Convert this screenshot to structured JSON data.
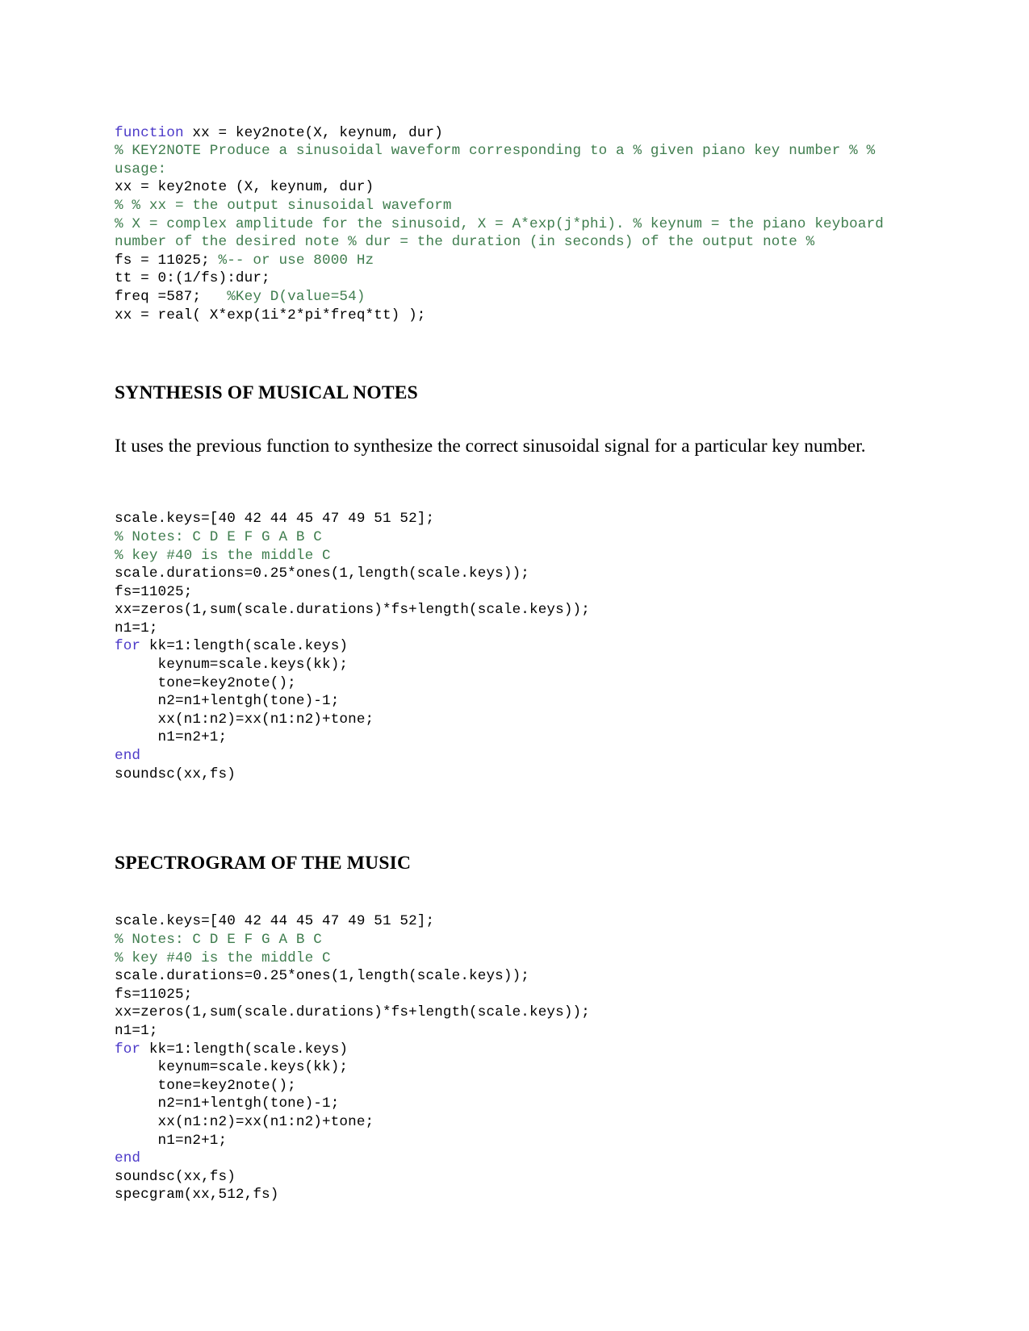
{
  "document": {
    "title": "Synthesis of Musical Notes - MATLAB code",
    "code_colors": {
      "keyword": "#4b39c8",
      "comment": "#3f7d4e",
      "plain": "#000000"
    }
  },
  "blocks": {
    "key2note_code": [
      [
        {
          "t": "function",
          "c": "kw"
        },
        {
          "t": " xx = key2note(X, keynum, dur)",
          "c": "plain"
        }
      ],
      [
        {
          "t": "% KEY2NOTE Produce a sinusoidal waveform corresponding to a % given piano key number % % usage:",
          "c": "comment"
        }
      ],
      [
        {
          "t": "xx = key2note (X, keynum, dur)",
          "c": "plain"
        }
      ],
      [
        {
          "t": "% % xx = the output sinusoidal waveform",
          "c": "comment"
        }
      ],
      [
        {
          "t": "% X = complex amplitude for the sinusoid, X = A*exp(j*phi). % keynum = the piano keyboard number of the desired note % dur = the duration (in seconds) of the output note %",
          "c": "comment"
        }
      ],
      [
        {
          "t": "fs = 11025; ",
          "c": "plain"
        },
        {
          "t": "%-- or use 8000 Hz",
          "c": "comment"
        }
      ],
      [
        {
          "t": "tt = 0:(1/fs):dur;",
          "c": "plain"
        }
      ],
      [
        {
          "t": "freq =587;   ",
          "c": "plain"
        },
        {
          "t": "%Key D(value=54)",
          "c": "comment"
        }
      ],
      [
        {
          "t": "xx = real( X*exp(1i*2*pi*freq*tt) );",
          "c": "plain"
        }
      ]
    ],
    "synthesis_heading": "SYNTHESIS OF MUSICAL NOTES",
    "synthesis_paragraph": "It uses the previous function to synthesize the correct sinusoidal signal for a particular key number.",
    "synthesis_code": [
      [
        {
          "t": "scale.keys=[40 42 44 45 47 49 51 52];",
          "c": "plain"
        }
      ],
      [
        {
          "t": "% Notes: C D E F G A B C",
          "c": "comment"
        }
      ],
      [
        {
          "t": "% key #40 is the middle C",
          "c": "comment"
        }
      ],
      [
        {
          "t": "scale.durations=0.25*ones(1,length(scale.keys));",
          "c": "plain"
        }
      ],
      [
        {
          "t": "fs=11025;",
          "c": "plain"
        }
      ],
      [
        {
          "t": "xx=zeros(1,sum(scale.durations)*fs+length(scale.keys));",
          "c": "plain"
        }
      ],
      [
        {
          "t": "n1=1;",
          "c": "plain"
        }
      ],
      [
        {
          "t": "for",
          "c": "kw"
        },
        {
          "t": " kk=1:length(scale.keys)",
          "c": "plain"
        }
      ],
      [
        {
          "t": "     keynum=scale.keys(kk);",
          "c": "plain"
        }
      ],
      [
        {
          "t": "     tone=key2note();",
          "c": "plain"
        }
      ],
      [
        {
          "t": "     n2=n1+lentgh(tone)-1;",
          "c": "plain"
        }
      ],
      [
        {
          "t": "     xx(n1:n2)=xx(n1:n2)+tone;",
          "c": "plain"
        }
      ],
      [
        {
          "t": "     n1=n2+1;",
          "c": "plain"
        }
      ],
      [
        {
          "t": "end",
          "c": "kw"
        }
      ],
      [
        {
          "t": "soundsc(xx,fs)",
          "c": "plain"
        }
      ]
    ],
    "spectrogram_heading": "SPECTROGRAM OF THE MUSIC",
    "spectrogram_code": [
      [
        {
          "t": "scale.keys=[40 42 44 45 47 49 51 52];",
          "c": "plain"
        }
      ],
      [
        {
          "t": "% Notes: C D E F G A B C",
          "c": "comment"
        }
      ],
      [
        {
          "t": "% key #40 is the middle C",
          "c": "comment"
        }
      ],
      [
        {
          "t": "scale.durations=0.25*ones(1,length(scale.keys));",
          "c": "plain"
        }
      ],
      [
        {
          "t": "fs=11025;",
          "c": "plain"
        }
      ],
      [
        {
          "t": "xx=zeros(1,sum(scale.durations)*fs+length(scale.keys));",
          "c": "plain"
        }
      ],
      [
        {
          "t": "n1=1;",
          "c": "plain"
        }
      ],
      [
        {
          "t": "for",
          "c": "kw"
        },
        {
          "t": " kk=1:length(scale.keys)",
          "c": "plain"
        }
      ],
      [
        {
          "t": "     keynum=scale.keys(kk);",
          "c": "plain"
        }
      ],
      [
        {
          "t": "     tone=key2note();",
          "c": "plain"
        }
      ],
      [
        {
          "t": "     n2=n1+lentgh(tone)-1;",
          "c": "plain"
        }
      ],
      [
        {
          "t": "     xx(n1:n2)=xx(n1:n2)+tone;",
          "c": "plain"
        }
      ],
      [
        {
          "t": "     n1=n2+1;",
          "c": "plain"
        }
      ],
      [
        {
          "t": "end",
          "c": "kw"
        }
      ],
      [
        {
          "t": "soundsc(xx,fs)",
          "c": "plain"
        }
      ],
      [
        {
          "t": "specgram(xx,512,fs)",
          "c": "plain"
        }
      ]
    ]
  }
}
